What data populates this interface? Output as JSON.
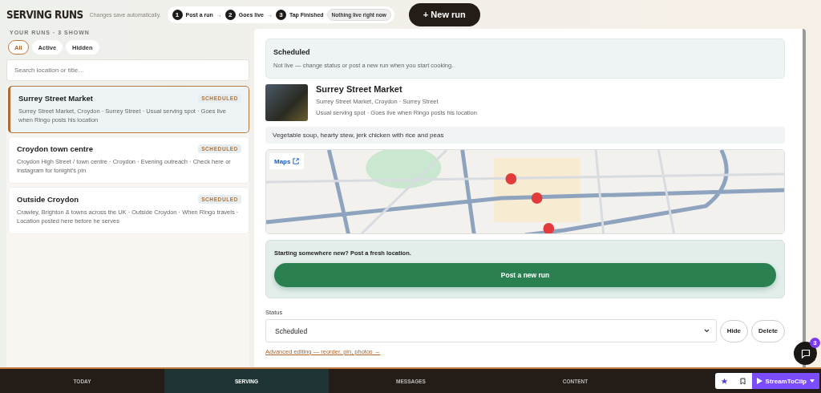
{
  "header": {
    "title": "SERVING RUNS",
    "autosave_note": "Changes save automatically.",
    "steps": [
      {
        "number": "1",
        "label": "Post a run"
      },
      {
        "number": "2",
        "label": "Goes live"
      },
      {
        "number": "3",
        "label": "Tap Finished"
      }
    ],
    "step_separator": "→",
    "live_status": "Nothing live right now",
    "new_run_button": "+ New run"
  },
  "sidebar": {
    "heading": "YOUR RUNS · 3 SHOWN",
    "filters": [
      {
        "label": "All",
        "selected": true
      },
      {
        "label": "Active",
        "selected": false
      },
      {
        "label": "Hidden",
        "selected": false
      }
    ],
    "search": {
      "placeholder": "Search location or title…"
    },
    "runs": [
      {
        "title": "Surrey Street Market",
        "badge": "SCHEDULED",
        "description": "Surrey Street Market, Croydon · Surrey Street · Usual serving spot · Goes live when Ringo posts his location",
        "selected": true
      },
      {
        "title": "Croydon town centre",
        "badge": "SCHEDULED",
        "description": "Croydon High Street / town centre · Croydon · Evening outreach · Check here or Instagram for tonight's pin",
        "selected": false
      },
      {
        "title": "Outside Croydon",
        "badge": "SCHEDULED",
        "description": "Crawley, Brighton & towns across the UK · Outside Croydon · When Ringo travels · Location posted here before he serves",
        "selected": false
      }
    ]
  },
  "detail": {
    "status_box": {
      "title": "Scheduled",
      "text": "Not live — change status or post a new run when you start cooking."
    },
    "run": {
      "title": "Surrey Street Market",
      "address": "Surrey Street Market, Croydon · Surrey Street",
      "note": "Usual serving spot · Goes live when Ringo posts his location"
    },
    "menu": "Vegetable soup, hearty stew, jerk chicken with rice and peas",
    "map": {
      "maps_link": "Maps"
    },
    "post_box": {
      "text": "Starting somewhere new? Post a fresh location.",
      "button": "Post a new run"
    },
    "status_label": "Status",
    "status_value": "Scheduled",
    "buttons": [
      "Hide",
      "Delete"
    ],
    "advanced_link": "Advanced editing — reorder, pin, photos →"
  },
  "chat": {
    "badge": "3"
  },
  "bottom_nav": [
    {
      "label": "TODAY",
      "selected": false
    },
    {
      "label": "SERVING",
      "selected": true
    },
    {
      "label": "MESSAGES",
      "selected": false
    },
    {
      "label": "CONTENT",
      "selected": false
    }
  ],
  "extension": {
    "label": "StreamToClip"
  }
}
